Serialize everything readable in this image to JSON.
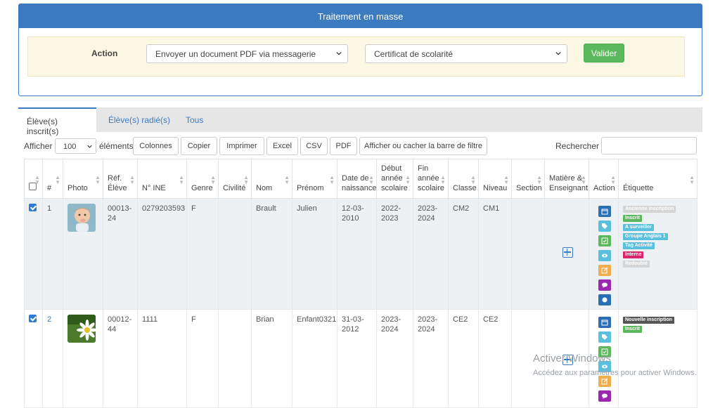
{
  "bulk": {
    "title": "Traitement en masse",
    "action_label": "Action",
    "action_select": "Envoyer un document PDF via messagerie",
    "document_select": "Certificat de scolarité",
    "validate_label": "Valider"
  },
  "tabs": [
    {
      "label": "Élève(s) inscrit(s)"
    },
    {
      "label": "Élève(s) radié(s)"
    },
    {
      "label": "Tous"
    }
  ],
  "toolbar": {
    "show_label": "Afficher",
    "length_value": "100",
    "elements_label": "éléments",
    "buttons": [
      "Colonnes",
      "Copier",
      "Imprimer",
      "Excel",
      "CSV",
      "PDF",
      "Afficher ou cacher la barre de filtre"
    ],
    "search_label": "Rechercher :"
  },
  "columns": [
    "#",
    "Photo",
    "Réf. Élève",
    "N° INE",
    "Genre",
    "Civilité",
    "Nom",
    "Prénom",
    "Date de naissance",
    "Début année scolaire",
    "Fin année scolaire",
    "Classe",
    "Niveau",
    "Section",
    "Matière & Enseignant",
    "Action",
    "Étiquette"
  ],
  "rows": [
    {
      "checked": true,
      "num": "1",
      "ref": "00013-24",
      "ine": "0279203593",
      "genre": "F",
      "civilite": "",
      "nom": "Brault",
      "prenom": "Julien",
      "naissance": "12-03-2010",
      "debut": "2022-2023",
      "fin": "2023-2024",
      "classe": "CM2",
      "niveau": "CM1",
      "section": "",
      "tags": [
        {
          "label": "Ancienne inscription",
          "color": "#d5d5d5"
        },
        {
          "label": "Inscrit",
          "color": "#5cb85c"
        },
        {
          "label": "A surveiller",
          "color": "#5bc0de"
        },
        {
          "label": "Groupe Anglais 1",
          "color": "#5bc0de"
        },
        {
          "label": "Tag Activité",
          "color": "#5bc0de"
        },
        {
          "label": "Interne",
          "color": "#d9256b"
        },
        {
          "label": "Redoublé",
          "color": "#d5d5d5"
        }
      ]
    },
    {
      "checked": true,
      "num": "2",
      "ref": "00012-44",
      "ine": "1111",
      "genre": "F",
      "civilite": "",
      "nom": "Brian",
      "prenom": "Enfant0321",
      "naissance": "31-03-2012",
      "debut": "2023-2024",
      "fin": "2023-2024",
      "classe": "CE2",
      "niveau": "CE2",
      "section": "",
      "tags": [
        {
          "label": "Nouvelle inscription",
          "color": "#555555"
        },
        {
          "label": "Inscrit",
          "color": "#5cb85c"
        }
      ]
    }
  ],
  "action_icons": [
    {
      "name": "calendar-icon",
      "color": "#2a6fb5"
    },
    {
      "name": "tag-icon",
      "color": "#5bc0de"
    },
    {
      "name": "check-square-icon",
      "color": "#5cb85c"
    },
    {
      "name": "eye-icon",
      "color": "#5bc0de"
    },
    {
      "name": "edit-icon",
      "color": "#f0ad4e"
    },
    {
      "name": "comment-icon",
      "color": "#9c27b0"
    },
    {
      "name": "circle-icon",
      "color": "#2a6fb5"
    }
  ],
  "watermark": {
    "title": "Activer Windows",
    "subtitle": "Accédez aux paramètres pour activer Windows."
  }
}
